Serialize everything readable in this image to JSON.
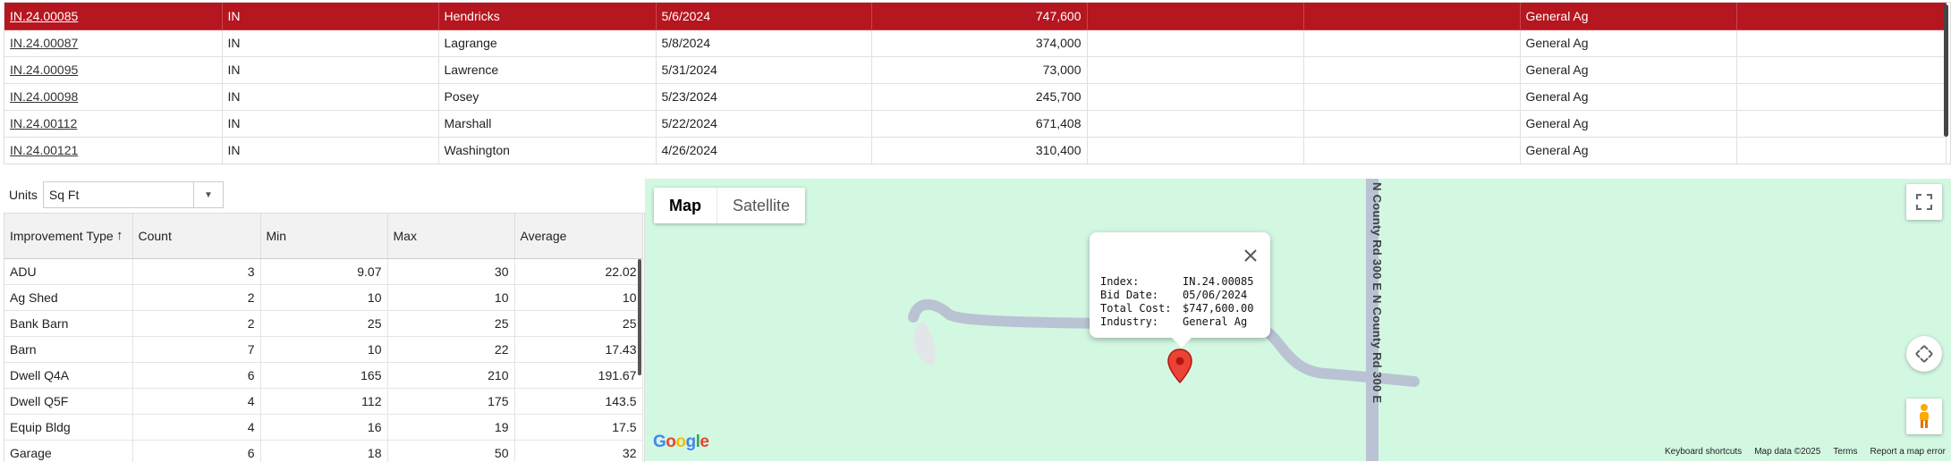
{
  "top_grid": {
    "rows": [
      {
        "index": "IN.24.00085",
        "state": "IN",
        "county": "Hendricks",
        "bid_date": "5/6/2024",
        "total": "747,600",
        "c6": "",
        "c7": "",
        "industry": "General Ag",
        "c9": "",
        "selected": true
      },
      {
        "index": "IN.24.00087",
        "state": "IN",
        "county": "Lagrange",
        "bid_date": "5/8/2024",
        "total": "374,000",
        "c6": "",
        "c7": "",
        "industry": "General Ag",
        "c9": ""
      },
      {
        "index": "IN.24.00095",
        "state": "IN",
        "county": "Lawrence",
        "bid_date": "5/31/2024",
        "total": "73,000",
        "c6": "",
        "c7": "",
        "industry": "General Ag",
        "c9": ""
      },
      {
        "index": "IN.24.00098",
        "state": "IN",
        "county": "Posey",
        "bid_date": "5/23/2024",
        "total": "245,700",
        "c6": "",
        "c7": "",
        "industry": "General Ag",
        "c9": ""
      },
      {
        "index": "IN.24.00112",
        "state": "IN",
        "county": "Marshall",
        "bid_date": "5/22/2024",
        "total": "671,408",
        "c6": "",
        "c7": "",
        "industry": "General Ag",
        "c9": ""
      },
      {
        "index": "IN.24.00121",
        "state": "IN",
        "county": "Washington",
        "bid_date": "4/26/2024",
        "total": "310,400",
        "c6": "",
        "c7": "",
        "industry": "General Ag",
        "c9": ""
      }
    ]
  },
  "units": {
    "label": "Units",
    "value": "Sq Ft"
  },
  "improvements": {
    "headers": {
      "type": "Improvement Type",
      "count": "Count",
      "min": "Min",
      "max": "Max",
      "avg": "Average"
    },
    "rows": [
      {
        "type": "ADU",
        "count": "3",
        "min": "9.07",
        "max": "30",
        "avg": "22.02"
      },
      {
        "type": "Ag Shed",
        "count": "2",
        "min": "10",
        "max": "10",
        "avg": "10"
      },
      {
        "type": "Bank Barn",
        "count": "2",
        "min": "25",
        "max": "25",
        "avg": "25"
      },
      {
        "type": "Barn",
        "count": "7",
        "min": "10",
        "max": "22",
        "avg": "17.43"
      },
      {
        "type": "Dwell Q4A",
        "count": "6",
        "min": "165",
        "max": "210",
        "avg": "191.67"
      },
      {
        "type": "Dwell Q5F",
        "count": "4",
        "min": "112",
        "max": "175",
        "avg": "143.5"
      },
      {
        "type": "Equip Bldg",
        "count": "4",
        "min": "16",
        "max": "19",
        "avg": "17.5"
      },
      {
        "type": "Garage",
        "count": "6",
        "min": "18",
        "max": "50",
        "avg": "32"
      }
    ]
  },
  "map": {
    "map_btn": "Map",
    "satellite_btn": "Satellite",
    "road_label_1": "N County Rd 300 E",
    "road_label_2": "N County Rd 300 E",
    "info": {
      "index_k": "Index:",
      "index_v": "IN.24.00085",
      "bid_k": "Bid Date:",
      "bid_v": "05/06/2024",
      "cost_k": "Total Cost:",
      "cost_v": "$747,600.00",
      "ind_k": "Industry:",
      "ind_v": "General Ag"
    },
    "google": "Google",
    "footer": {
      "shortcuts": "Keyboard shortcuts",
      "data": "Map data ©2025",
      "terms": "Terms",
      "report": "Report a map error"
    },
    "colors": {
      "land": "#d3f8e2",
      "road": "#b9c3d3",
      "marker": "#ea4335"
    }
  }
}
